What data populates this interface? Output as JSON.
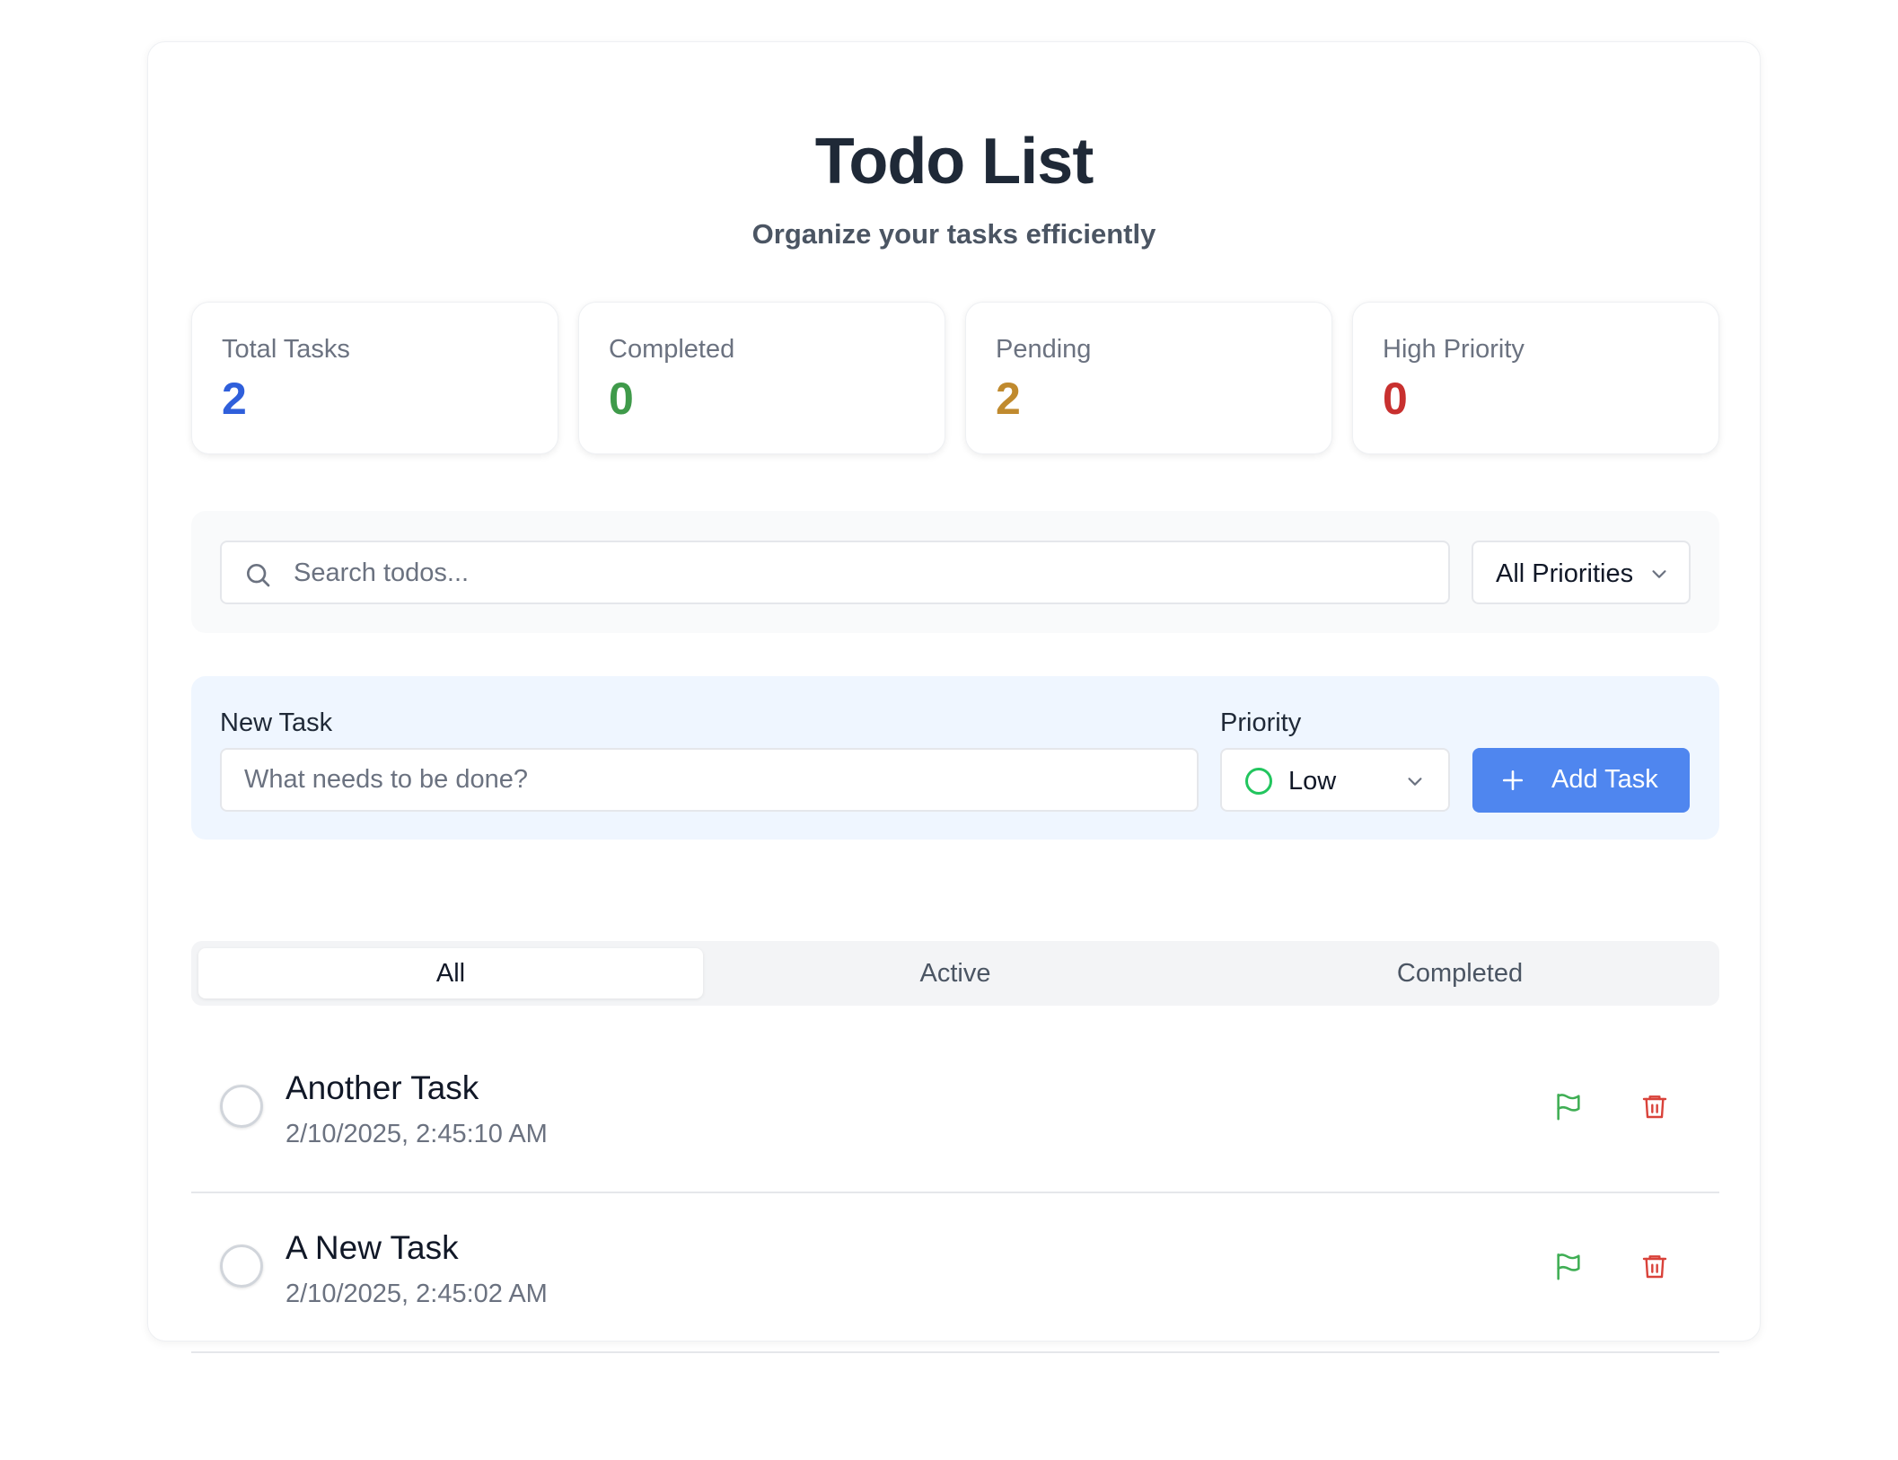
{
  "header": {
    "title": "Todo List",
    "subtitle": "Organize your tasks efficiently"
  },
  "stats": [
    {
      "label": "Total Tasks",
      "value": "2",
      "color": "#2f5fdb"
    },
    {
      "label": "Completed",
      "value": "0",
      "color": "#3f9a4a"
    },
    {
      "label": "Pending",
      "value": "2",
      "color": "#c08a2e"
    },
    {
      "label": "High Priority",
      "value": "0",
      "color": "#c8302f"
    }
  ],
  "search": {
    "placeholder": "Search todos...",
    "value": "",
    "icon": "search-icon",
    "filter_label": "All Priorities"
  },
  "new_task": {
    "task_label": "New Task",
    "task_placeholder": "What needs to be done?",
    "task_value": "",
    "priority_label": "Priority",
    "priority_value": "Low",
    "priority_color": "#22c55e",
    "add_button": "Add Task"
  },
  "tabs": [
    {
      "label": "All",
      "active": true
    },
    {
      "label": "Active",
      "active": false
    },
    {
      "label": "Completed",
      "active": false
    }
  ],
  "todos": [
    {
      "name": "Another Task",
      "date": "2/10/2025, 2:45:10 AM",
      "completed": false,
      "priority_color": "#3fae54"
    },
    {
      "name": "A New Task",
      "date": "2/10/2025, 2:45:02 AM",
      "completed": false,
      "priority_color": "#3fae54"
    }
  ],
  "colors": {
    "accent": "#4f86ef",
    "delete": "#d9423a"
  }
}
